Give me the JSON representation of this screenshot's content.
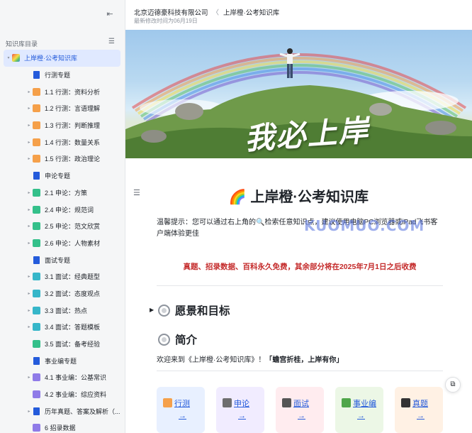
{
  "sidebar": {
    "collapse_icon": "collapse-sidebar-icon",
    "toc_title": "知识库目录",
    "toc_toggle_icon": "list-settings-icon",
    "items": [
      {
        "label": "上岸橙·公考知识库",
        "level": 0,
        "arrow": "▾",
        "icon": "rainbow",
        "color": "#ff8a3d",
        "active": true
      },
      {
        "label": "行测专题",
        "level": 1,
        "arrow": "",
        "icon": "doc",
        "color": "#245bdb"
      },
      {
        "label": "1.1 行测：资料分析",
        "level": 1,
        "arrow": "▸",
        "icon": "sheet",
        "color": "#f5a04a"
      },
      {
        "label": "1.2 行测：言语理解",
        "level": 1,
        "arrow": "▸",
        "icon": "sheet",
        "color": "#f5a04a"
      },
      {
        "label": "1.3 行测：判断推理",
        "level": 1,
        "arrow": "▸",
        "icon": "sheet",
        "color": "#f5a04a"
      },
      {
        "label": "1.4 行测：数量关系",
        "level": 1,
        "arrow": "▸",
        "icon": "sheet",
        "color": "#f5a04a"
      },
      {
        "label": "1.5 行测：政治理论",
        "level": 1,
        "arrow": "▸",
        "icon": "sheet",
        "color": "#f5a04a"
      },
      {
        "label": "申论专题",
        "level": 1,
        "arrow": "",
        "icon": "doc",
        "color": "#245bdb"
      },
      {
        "label": "2.1 申论：方策",
        "level": 1,
        "arrow": "▸",
        "icon": "sheet",
        "color": "#34c08a"
      },
      {
        "label": "2.4 申论：规范词",
        "level": 1,
        "arrow": "▸",
        "icon": "sheet",
        "color": "#34c08a"
      },
      {
        "label": "2.5 申论：范文欣赏",
        "level": 1,
        "arrow": "▸",
        "icon": "sheet",
        "color": "#34c08a"
      },
      {
        "label": "2.6 申论：人物素材",
        "level": 1,
        "arrow": "▸",
        "icon": "sheet",
        "color": "#34c08a"
      },
      {
        "label": "面试专题",
        "level": 1,
        "arrow": "",
        "icon": "doc",
        "color": "#245bdb"
      },
      {
        "label": "3.1 面试：经典题型",
        "level": 1,
        "arrow": "▸",
        "icon": "sheet",
        "color": "#36b6c9"
      },
      {
        "label": "3.2 面试：态度观点",
        "level": 1,
        "arrow": "▸",
        "icon": "sheet",
        "color": "#36b6c9"
      },
      {
        "label": "3.3 面试：热点",
        "level": 1,
        "arrow": "▸",
        "icon": "sheet",
        "color": "#36b6c9"
      },
      {
        "label": "3.4 面试：答题模板",
        "level": 1,
        "arrow": "▸",
        "icon": "sheet",
        "color": "#36b6c9"
      },
      {
        "label": "3.5 面试：备考经验",
        "level": 1,
        "arrow": "",
        "icon": "sheet",
        "color": "#34c08a"
      },
      {
        "label": "事业编专题",
        "level": 1,
        "arrow": "",
        "icon": "doc",
        "color": "#245bdb"
      },
      {
        "label": "4.1 事业编：公基常识",
        "level": 1,
        "arrow": "▸",
        "icon": "sheet",
        "color": "#8f7be8"
      },
      {
        "label": "4.2 事业编：综应资料",
        "level": 1,
        "arrow": "",
        "icon": "sheet",
        "color": "#8f7be8"
      },
      {
        "label": "历年真题、答案及解析（...",
        "level": 1,
        "arrow": "▸",
        "icon": "doc",
        "color": "#245bdb"
      },
      {
        "label": "6 招录数据",
        "level": 1,
        "arrow": "",
        "icon": "sheet",
        "color": "#8f7be8"
      }
    ]
  },
  "header": {
    "breadcrumb_root": "北京迈德豪科技有限公司",
    "breadcrumb_sep": "〈",
    "breadcrumb_current": "上岸橙·公考知识库",
    "modified": "最新修改时间为06月19日"
  },
  "banner": {
    "text": "我必上岸"
  },
  "doc": {
    "outline_icon": "outline-icon",
    "title_emoji": "🌈",
    "title": "上岸橙·公考知识库",
    "tip_prefix": "温馨提示：您可以通过右上角的",
    "tip_search": "🔍",
    "tip_suffix": "检索任意知识点，建议使用电脑PC浏览器或iPad飞书客户端体验更佳",
    "watermark": "KUOMUO.COM",
    "notice": "真题、招录数据、百科永久免费，其余部分将在2025年7月1日之后收费",
    "h2_vision": "愿景和目标",
    "h2_intro": "简介",
    "intro_text": "欢迎来到《上岸橙·公考知识库》！",
    "intro_bold": "「蟾宫折桂，上岸有你」",
    "cards": [
      {
        "label": "行测",
        "arrow": "→",
        "bg": "#e8f0ff",
        "icon_color": "#f5a04a"
      },
      {
        "label": "申论",
        "arrow": "→",
        "bg": "#f1ecff",
        "icon_color": "#6e6e6e"
      },
      {
        "label": "面试",
        "arrow": "→",
        "bg": "#ffecef",
        "icon_color": "#555"
      },
      {
        "label": "事业编",
        "arrow": "→",
        "bg": "#ecf7e6",
        "icon_color": "#4fa64a"
      },
      {
        "label": "真题",
        "arrow": "→",
        "bg": "#fff1e4",
        "icon_color": "#333"
      }
    ]
  },
  "float_button_icon": "copy-link-icon"
}
